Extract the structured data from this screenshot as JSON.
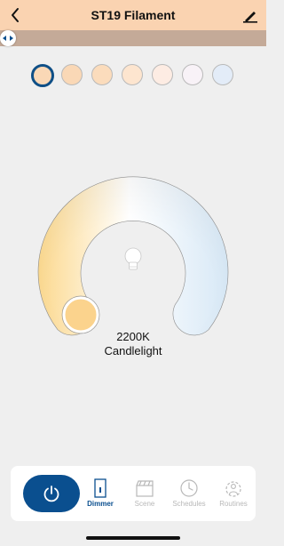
{
  "header": {
    "title": "ST19 Filament"
  },
  "swatches": [
    {
      "color": "#fad8b6",
      "selected": true
    },
    {
      "color": "#fad8b6",
      "selected": false
    },
    {
      "color": "#fbdcbc",
      "selected": false
    },
    {
      "color": "#fde5cf",
      "selected": false
    },
    {
      "color": "#fdece3",
      "selected": false
    },
    {
      "color": "#f8f2f7",
      "selected": false
    },
    {
      "color": "#e3ecf8",
      "selected": false
    }
  ],
  "dial": {
    "temperature": "2200K",
    "mode": "Candlelight",
    "colors": {
      "warm": "#fcd98f",
      "mid": "#ffffff",
      "cool": "#d7e8f6"
    }
  },
  "tabs": [
    {
      "label": "Dimmer",
      "icon": "dimmer-icon",
      "active": true
    },
    {
      "label": "Scene",
      "icon": "scene-icon",
      "active": false
    },
    {
      "label": "Schedules",
      "icon": "clock-icon",
      "active": false
    },
    {
      "label": "Routines",
      "icon": "routines-icon",
      "active": false
    }
  ],
  "colors": {
    "accent": "#0a4f8f",
    "header": "#fad3b1",
    "slider": "#c4aa98"
  }
}
